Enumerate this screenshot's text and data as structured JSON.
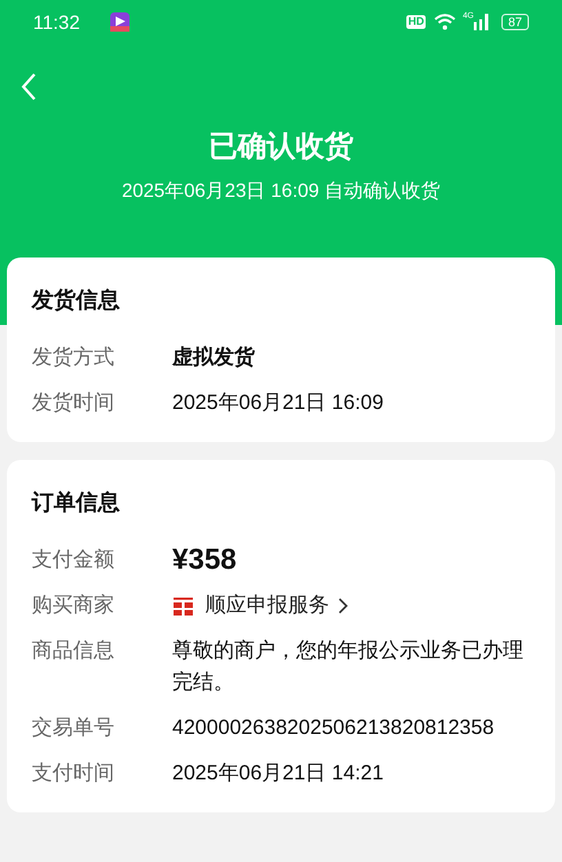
{
  "status_bar": {
    "time": "11:32",
    "hd": "HD",
    "network": "4G",
    "battery": "87"
  },
  "header": {
    "title": "已确认收货",
    "subtitle": "2025年06月23日 16:09 自动确认收货"
  },
  "sections": [
    {
      "title": "发货信息",
      "rows": [
        {
          "kind": "text",
          "label": "发货方式",
          "value": "虚拟发货",
          "bold": true
        },
        {
          "kind": "text",
          "label": "发货时间",
          "value": "2025年06月21日 16:09",
          "bold": false
        }
      ]
    },
    {
      "title": "订单信息",
      "rows": [
        {
          "kind": "amount",
          "label": "支付金额",
          "value": "¥358"
        },
        {
          "kind": "merchant",
          "label": "购买商家",
          "value": "顺应申报服务"
        },
        {
          "kind": "text",
          "label": "商品信息",
          "value": "尊敬的商户，您的年报公示业务已办理完结。",
          "bold": false
        },
        {
          "kind": "text",
          "label": "交易单号",
          "value": "4200002638202506213820812358",
          "bold": false
        },
        {
          "kind": "text",
          "label": "支付时间",
          "value": "2025年06月21日 14:21",
          "bold": false
        }
      ]
    }
  ]
}
